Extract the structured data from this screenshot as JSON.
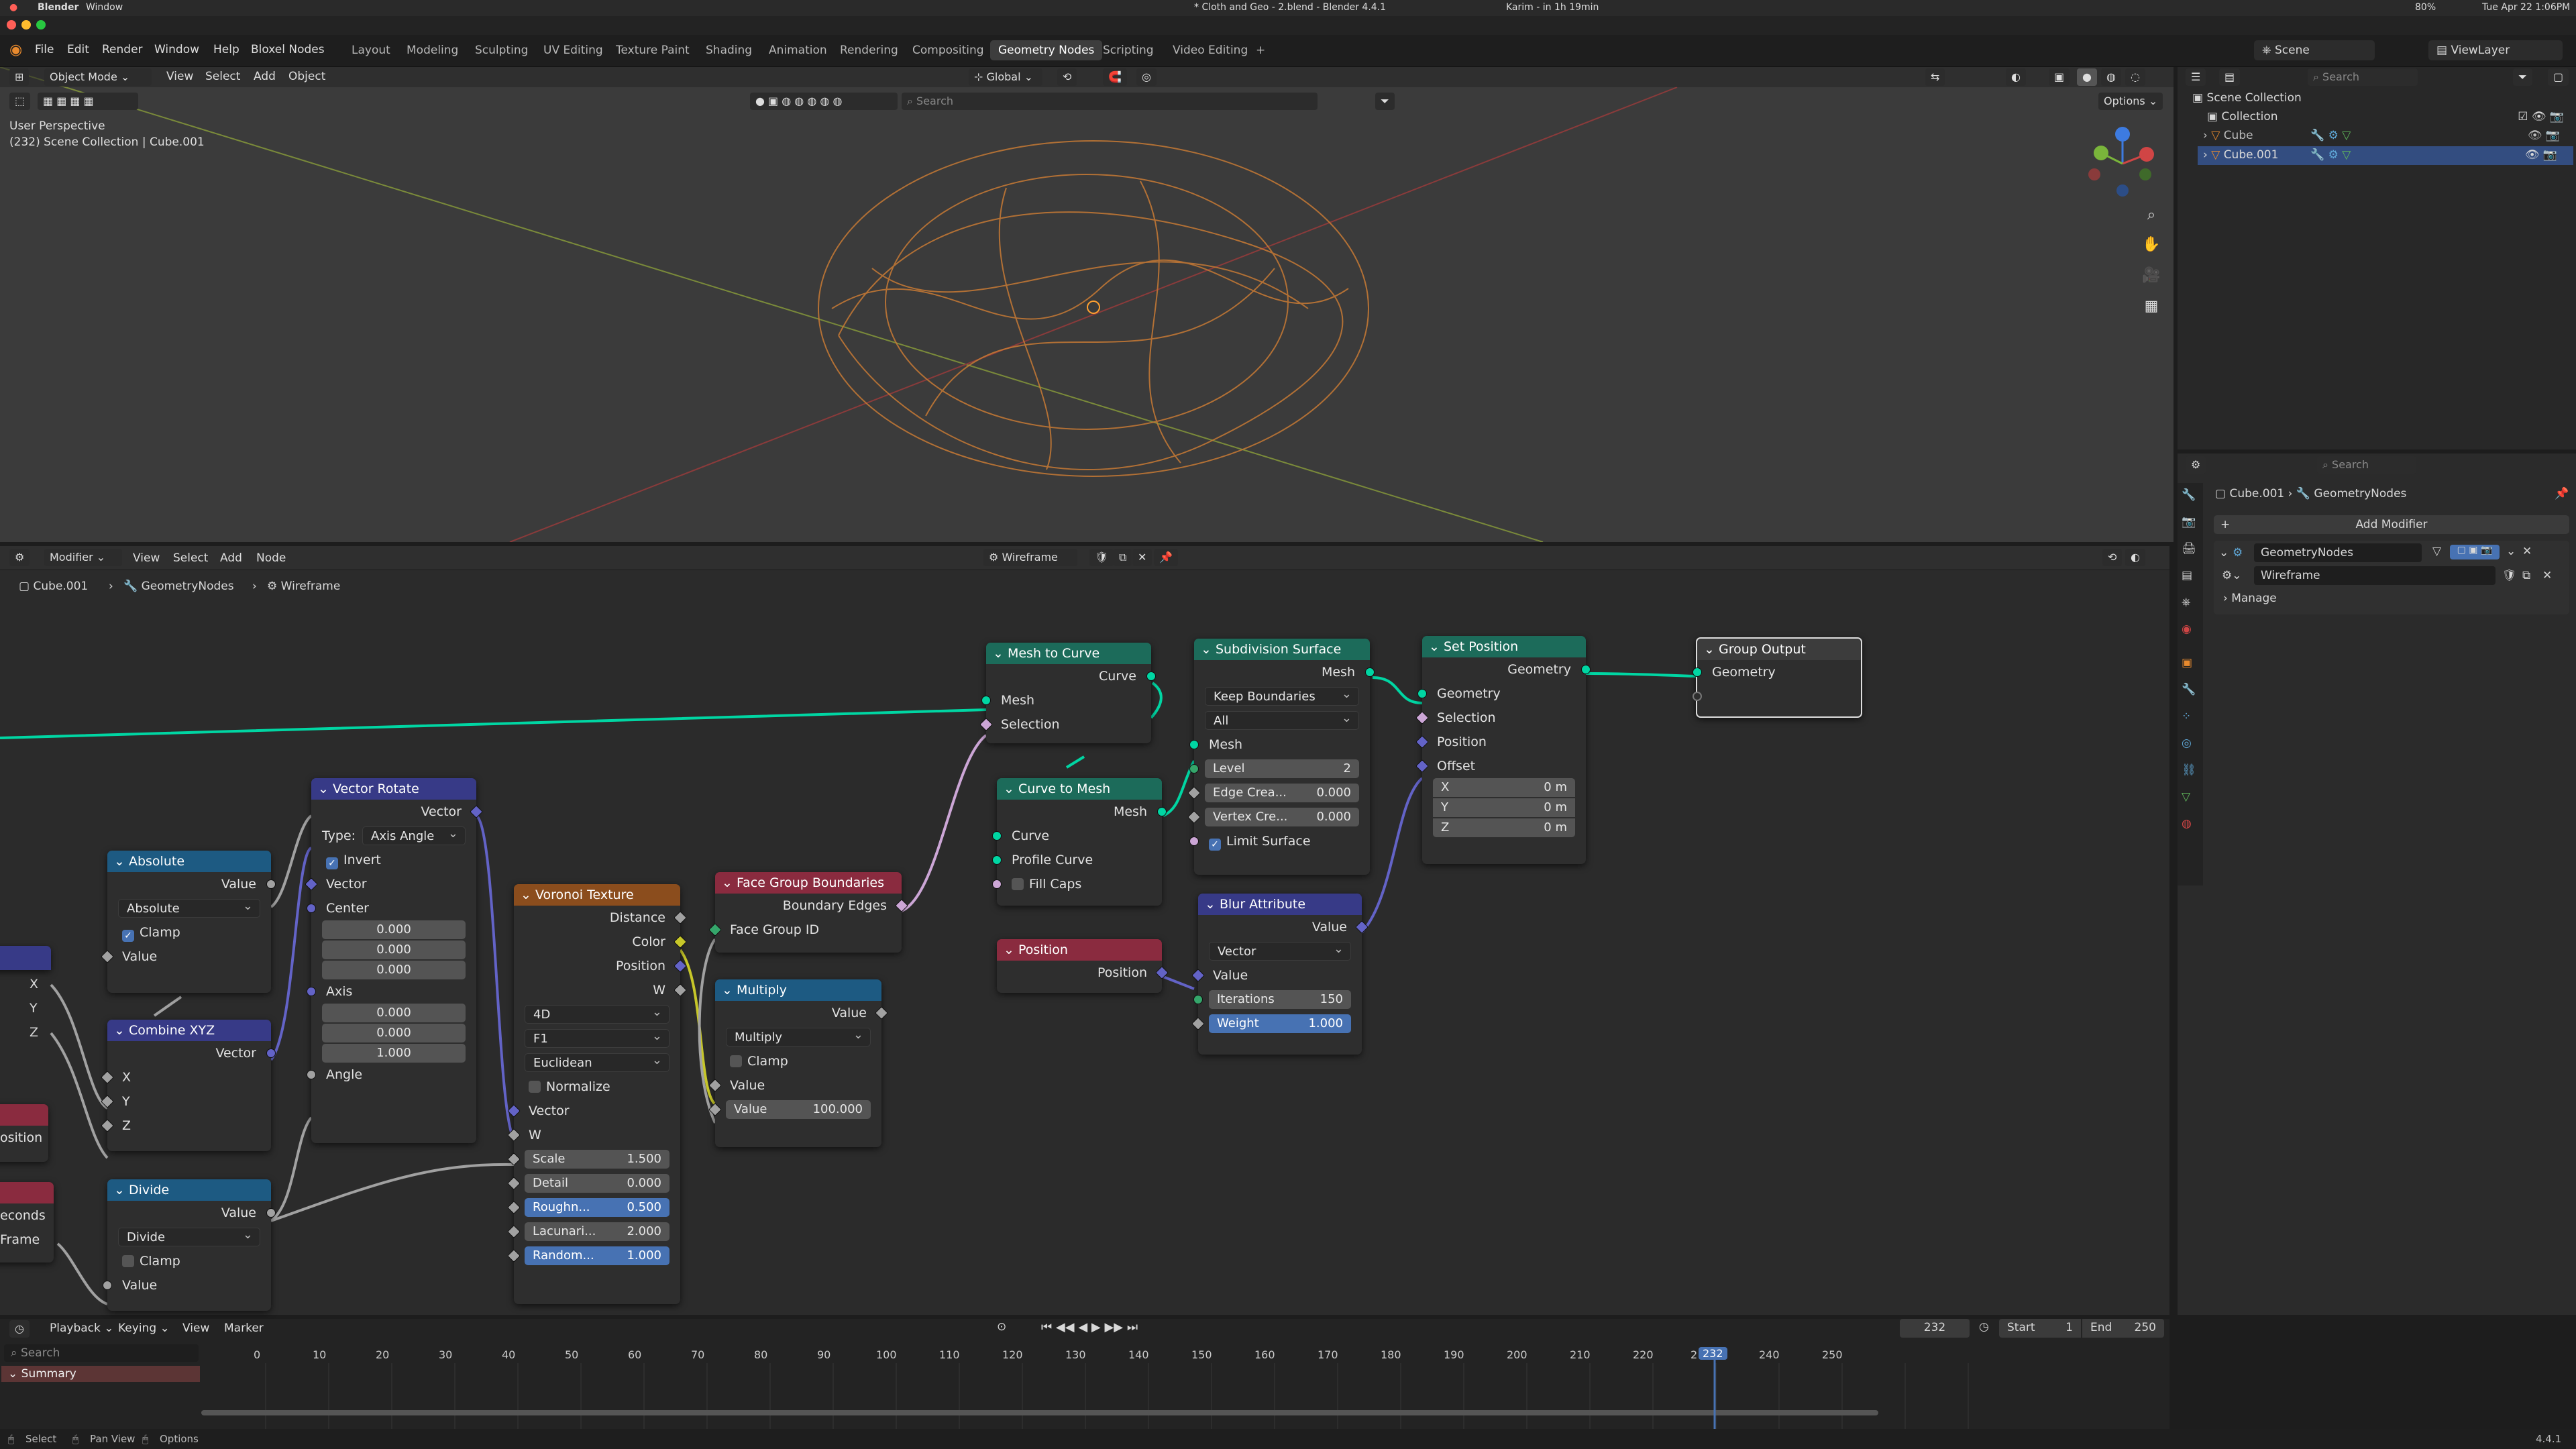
{
  "macos": {
    "app": "Blender",
    "menu": "Window",
    "title": "* Cloth and Geo - 2.blend - Blender 4.4.1",
    "status_text": "Karim - in 1h 19min",
    "battery": "80%",
    "clock": "Tue Apr 22 1:06PM"
  },
  "menus": [
    "File",
    "Edit",
    "Render",
    "Window",
    "Help",
    "Bloxel Nodes"
  ],
  "workspaces": [
    "Layout",
    "Modeling",
    "Sculpting",
    "UV Editing",
    "Texture Paint",
    "Shading",
    "Animation",
    "Rendering",
    "Compositing",
    "Geometry Nodes",
    "Scripting",
    "Video Editing"
  ],
  "active_workspace": "Geometry Nodes",
  "scene": {
    "label": "Scene",
    "view_layer": "ViewLayer"
  },
  "viewport": {
    "mode": "Object Mode",
    "menus": [
      "View",
      "Select",
      "Add",
      "Object"
    ],
    "orientation": "Global",
    "search_placeholder": "Search",
    "options": "Options",
    "perspective": "User Perspective",
    "context": "(232) Scene Collection | Cube.001"
  },
  "node_editor": {
    "mode": "Modifier",
    "menus": [
      "View",
      "Select",
      "Add",
      "Node"
    ],
    "tree_name": "Wireframe",
    "breadcrumb": [
      "Cube.001",
      "GeometryNodes",
      "Wireframe"
    ]
  },
  "nodes": {
    "mesh_to_curve": {
      "title": "Mesh to Curve",
      "out": "Curve",
      "in1": "Mesh",
      "in2": "Selection"
    },
    "subdiv": {
      "title": "Subdivision Surface",
      "out": "Mesh",
      "dd1": "Keep Boundaries",
      "dd2": "All",
      "in_mesh": "Mesh",
      "level_label": "Level",
      "level": "2",
      "edge_label": "Edge Crea...",
      "edge": "0.000",
      "vert_label": "Vertex Cre...",
      "vert": "0.000",
      "limit": "Limit Surface"
    },
    "set_position": {
      "title": "Set Position",
      "out": "Geometry",
      "in_geo": "Geometry",
      "in_sel": "Selection",
      "in_pos": "Position",
      "in_off": "Offset",
      "x_label": "X",
      "x": "0 m",
      "y_label": "Y",
      "y": "0 m",
      "z_label": "Z",
      "z": "0 m"
    },
    "group_output": {
      "title": "Group Output",
      "in": "Geometry"
    },
    "curve_to_mesh": {
      "title": "Curve to Mesh",
      "out": "Mesh",
      "in_curve": "Curve",
      "in_profile": "Profile Curve",
      "fill": "Fill Caps"
    },
    "blur": {
      "title": "Blur Attribute",
      "out": "Value",
      "dd": "Vector",
      "in_val": "Value",
      "it_label": "Iterations",
      "it": "150",
      "w_label": "Weight",
      "w": "1.000"
    },
    "position": {
      "title": "Position",
      "out": "Position"
    },
    "face_group": {
      "title": "Face Group Boundaries",
      "out": "Boundary Edges",
      "in": "Face Group ID"
    },
    "multiply": {
      "title": "Multiply",
      "out": "Value",
      "dd": "Multiply",
      "clamp": "Clamp",
      "in_val": "Value",
      "val_label": "Value",
      "val": "100.000"
    },
    "voronoi": {
      "title": "Voronoi Texture",
      "o1": "Distance",
      "o2": "Color",
      "o3": "Position",
      "o4": "W",
      "dd1": "4D",
      "dd2": "F1",
      "dd3": "Euclidean",
      "normalize": "Normalize",
      "in_vec": "Vector",
      "in_w": "W",
      "scale_label": "Scale",
      "scale": "1.500",
      "detail_label": "Detail",
      "detail": "0.000",
      "rough_label": "Roughn...",
      "rough": "0.500",
      "lac_label": "Lacunari...",
      "lac": "2.000",
      "rand_label": "Random...",
      "rand": "1.000"
    },
    "vector_rotate": {
      "title": "Vector Rotate",
      "out": "Vector",
      "type_label": "Type:",
      "type": "Axis Angle",
      "invert": "Invert",
      "in_vec": "Vector",
      "in_center": "Center",
      "c1": "0.000",
      "c2": "0.000",
      "c3": "0.000",
      "in_axis": "Axis",
      "a1": "0.000",
      "a2": "0.000",
      "a3": "1.000",
      "in_angle": "Angle"
    },
    "absolute": {
      "title": "Absolute",
      "out": "Value",
      "dd": "Absolute",
      "clamp": "Clamp",
      "in": "Value"
    },
    "combine_xyz": {
      "title": "Combine XYZ",
      "out": "Vector",
      "x": "X",
      "y": "Y",
      "z": "Z"
    },
    "divide": {
      "title": "Divide",
      "out": "Value",
      "dd": "Divide",
      "clamp": "Clamp",
      "in": "Value"
    },
    "partial": {
      "x": "X",
      "y": "Y",
      "z": "Z",
      "position": "osition",
      "seconds": "econds",
      "frame": "Frame"
    }
  },
  "outliner": {
    "search_placeholder": "Search",
    "root": "Scene Collection",
    "items": [
      {
        "label": "Collection"
      },
      {
        "label": "Cube"
      },
      {
        "label": "Cube.001"
      }
    ]
  },
  "properties": {
    "search_placeholder": "Search",
    "object": "Cube.001",
    "modifier_tab": "GeometryNodes",
    "add_modifier": "Add Modifier",
    "modifier_name": "GeometryNodes",
    "node_group": "Wireframe",
    "manage": "Manage"
  },
  "timeline": {
    "menus": [
      "Playback",
      "Keying",
      "View",
      "Marker"
    ],
    "current_frame": "232",
    "start_label": "Start",
    "start": "1",
    "end_label": "End",
    "end": "250",
    "search_placeholder": "Search",
    "summary": "Summary",
    "ticks": [
      "0",
      "10",
      "20",
      "30",
      "40",
      "50",
      "60",
      "70",
      "80",
      "90",
      "100",
      "110",
      "120",
      "130",
      "140",
      "150",
      "160",
      "170",
      "180",
      "190",
      "200",
      "210",
      "220",
      "2",
      "240",
      "250"
    ],
    "playhead": "232"
  },
  "statusbar": {
    "select": "Select",
    "pan": "Pan View",
    "options": "Options",
    "version": "4.4.1"
  }
}
